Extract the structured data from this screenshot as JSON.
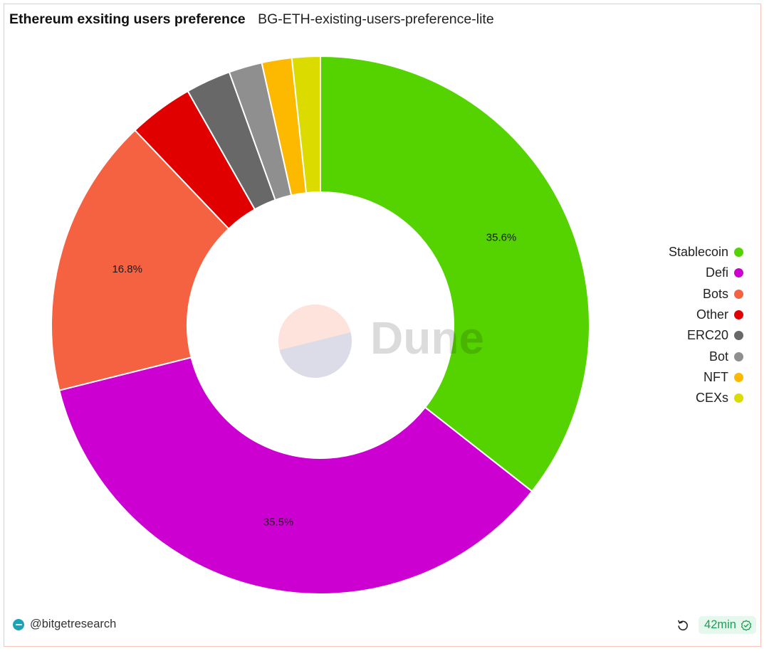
{
  "header": {
    "title": "Ethereum exsiting users preference",
    "subtitle": "BG-ETH-existing-users-preference-lite"
  },
  "chart_data": {
    "type": "pie",
    "variant": "donut",
    "title": "Ethereum exsiting users preference",
    "subtitle": "BG-ETH-existing-users-preference-lite",
    "unit": "percent",
    "legend_position": "right",
    "categories": [
      "Stablecoin",
      "Defi",
      "Bots",
      "Other",
      "ERC20",
      "Bot",
      "NFT",
      "CEXs"
    ],
    "values": [
      35.6,
      35.5,
      16.8,
      3.9,
      2.7,
      2.0,
      1.8,
      1.7
    ],
    "colors": [
      "#55d300",
      "#cc00d1",
      "#f46241",
      "#e00000",
      "#686868",
      "#8f8f8f",
      "#fdb900",
      "#dcdb00"
    ],
    "data_labels": [
      {
        "category": "Stablecoin",
        "text": "35.6%"
      },
      {
        "category": "Defi",
        "text": "35.5%"
      },
      {
        "category": "Bots",
        "text": "16.8%"
      }
    ],
    "watermark": "Dune"
  },
  "footer": {
    "author": "@bitgetresearch",
    "refresh_age": "42min"
  }
}
